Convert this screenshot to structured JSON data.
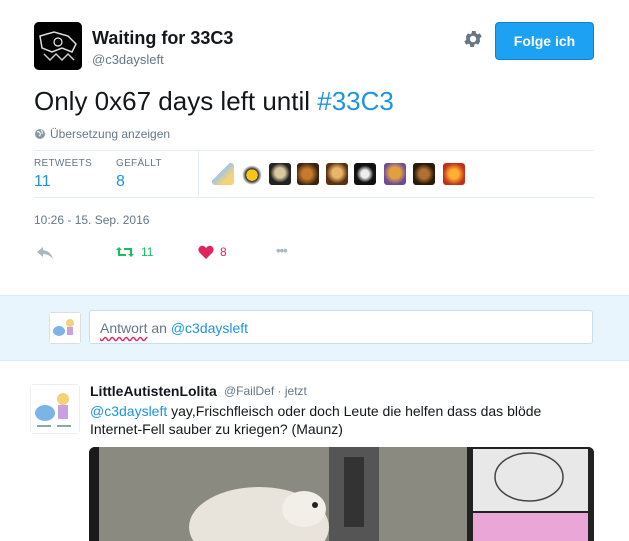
{
  "tweet": {
    "display_name": "Waiting for 33C3",
    "handle": "@c3daysleft",
    "follow_label": "Folge ich",
    "text_main": "Only 0x67 days left until ",
    "hashtag": "#33C3",
    "translate_label": "Übersetzung anzeigen",
    "retweets_label": "RETWEETS",
    "retweets_count": "11",
    "likes_label": "GEFÄLLT",
    "likes_count": "8",
    "timestamp": "10:26 - 15. Sep. 2016",
    "action_retweet_count": "11",
    "action_like_count": "8",
    "more_glyph": "•••"
  },
  "reply_box": {
    "word": "Antwort",
    "connector": " an ",
    "mention": "@c3daysleft"
  },
  "reply": {
    "display_name": "LittleAutistenLolita",
    "handle": "@FailDef",
    "separator": " · ",
    "time": "jetzt",
    "mention": "@c3daysleft",
    "text": " yay,Frischfleisch oder doch Leute die helfen dass das blöde Internet-Fell sauber zu kriegen? (Maunz)"
  },
  "colors": {
    "accent": "#1da1f2",
    "link": "#1b95e0",
    "retweet_green": "#17bf63",
    "like_red": "#e0245e",
    "muted": "#657786"
  },
  "icons": [
    "gear-icon",
    "globe-icon",
    "reply-icon",
    "retweet-icon",
    "heart-icon",
    "more-icon"
  ]
}
